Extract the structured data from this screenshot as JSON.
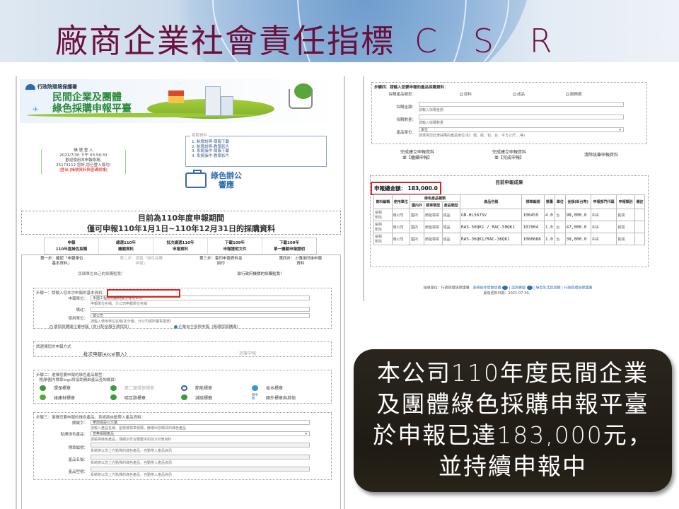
{
  "slide": {
    "title": "廠商企業社會責任指標",
    "title_suffix": "C S R"
  },
  "left_screenshot": {
    "agency": "行政院環境保護署",
    "site_title_line1": "民間企業及團體",
    "site_title_line2": "綠色採購申報平臺",
    "login": {
      "heading": "帳 號 登 入",
      "datetime": "2021/7/30 下午 03:56:33",
      "welcome": "歡迎使用本申報系統,",
      "user_msg": "25173112 您好,您已登入成功!",
      "logout": "|登出",
      "edit_account": "|帳號資料與密碼修護|"
    },
    "reference": {
      "legend": "相關資料",
      "items": [
        "1. 制度說明-簡報下載",
        "2. 制度說明-教學影片",
        "3. 系統操作-簡報下載",
        "4. 系統操作-教學影片"
      ]
    },
    "green_office": {
      "line1": "綠色辦公",
      "line2": "響應"
    },
    "period": {
      "line1": "目前為110年度申報期間",
      "line2": "僅可申報110年1月1日~110年12月31日的採購資料"
    },
    "tabs": [
      {
        "line1": "申報",
        "line2": "110年度綠色採購"
      },
      {
        "line1": "總選110年",
        "line2": "機關資料"
      },
      {
        "line1": "批次總選110年",
        "line2": "申報資料"
      },
      {
        "line1": "下載109年",
        "line2": "申報證明文件"
      },
      {
        "line1": "下載109年",
        "line2": "單一機關申報證明"
      }
    ],
    "steps": [
      {
        "line1": "第一步：確認「申報單位",
        "line2": "基本資料」",
        "dim": false
      },
      {
        "line1": "第二步：填報「綠色採購",
        "line2": "申報」",
        "dim": true
      },
      {
        "line1": "第三步：套印申報資料並",
        "line2": "用印",
        "dim": false
      },
      {
        "line1": "第四步：上傳用印後申報",
        "line2": "資料",
        "dim": false
      }
    ],
    "notes": [
      "民間單位自己的採購點我！",
      "執行政府機關的採購點我！"
    ],
    "step1": {
      "title": "步驟一：請輸入您本次申報的基本資料：",
      "unit_label": "申報單位：",
      "unit_value": "禾圃工程技術顧問股份有限公司",
      "unit_hint": "申報單位名稱、分公司申報單位名稱",
      "remark_label": "備註：",
      "remark_value": "",
      "user_unit_label": "使用單位：",
      "user_unit_value": "總公司",
      "user_unit_hint": "請輸入使用單位名稱(如分廠、分公司或所屬事業部)",
      "radio1": "環保局輔導企業申報（會分配金額至環保局）",
      "radio2": "企業自主參與申報（無環保局輔導）",
      "selected_radio": 2
    },
    "method": {
      "title": "請選擇您的申報方式",
      "batch": "批次申報(excel匯入)",
      "single": "逐筆申報"
    },
    "step2": {
      "title": "步驟二：選擇您要申報的綠色產品類型：",
      "subtitle": "（點擊圖內標章logo將協助開啟產品查詢網頁）",
      "marks": [
        {
          "label": "環保標章",
          "icon": "eco-label-icon",
          "color": "#3b9a3b",
          "dim": false
        },
        {
          "label": "第二類環保標章",
          "icon": "type2-eco-label-icon",
          "color": "#3b9a3b",
          "dim": true
        },
        {
          "label": "節能標章",
          "icon": "energy-label-icon",
          "color": "#2c5fb0",
          "dim": false
        },
        {
          "label": "省水標章",
          "icon": "water-label-icon",
          "color": "#2a9ad8",
          "dim": false
        },
        {
          "label": "綠建材標章",
          "icon": "green-building-label-icon",
          "color": "#5aa53c",
          "dim": false
        },
        {
          "label": "碳足跡標章",
          "icon": "carbon-footprint-label-icon",
          "color": "#3b9a3b",
          "dim": false
        },
        {
          "label": "減碳標籤",
          "icon": "carbon-reduction-label-icon",
          "color": "#3b9a3b",
          "dim": false
        },
        {
          "label": "國外標章與其他",
          "icon": "foreign-label-icon",
          "color": "#3a67a8",
          "dim": false
        }
      ],
      "carbon_neutral": "碳中\n和"
    },
    "step3": {
      "title": "步驟三：選擇您要申報的綠色產品，系統將自動帶入產品資料：",
      "keyword_label": "關鍵字：",
      "keyword_value": "華鼎開設公文櫃",
      "keyword_hint": "請輸入產品名稱、型號或標章號碼，篩選出您購買的綠色產品",
      "product_label": "點擇綠色產品：",
      "product_value": "查無相關產品",
      "product_hint": "請點擇綠色產品，僅顯示符合關鍵字的前100筆資料",
      "cert_label": "標章編號：",
      "name_label": "產品名稱：",
      "model_label": "產品型號：",
      "auto_hint": "系統將以您上方點擇的綠色產品，自動帶入產品資訊"
    }
  },
  "right_screenshot": {
    "step4": {
      "title": "步驟四：請輸入您要申報的產品採購資料：",
      "type_label": "採購產品類型：",
      "type_options": [
        "原料",
        "成品",
        "服務類"
      ],
      "amount_label": "採購金額：",
      "amount_hint": "請輸入採購金額",
      "qty_label": "採購數量：",
      "qty_hint": "請輸入採購數量",
      "unit_label": "產品單位：",
      "unit_value": "單位",
      "unit_hint": "請選擇您此筆採購的產品單位(如：個、瓶、包、台、平方公尺....等)"
    },
    "actions": [
      {
        "line1": "完成建立申報資料",
        "line2": "並【繼續申報】"
      },
      {
        "line1": "完成建立申報資料",
        "line2": "並【完成申報】"
      },
      {
        "line1": "清除該筆申報資料",
        "line2": ""
      }
    ],
    "results": {
      "title": "目前申報成果",
      "total_label": "申報總金額：",
      "total_value": "183,000.0",
      "headers": {
        "record": "資料編輯",
        "user_unit": "使用單位",
        "green_type": "綠色產品種類",
        "domestic": "國內外",
        "label_type": "標章類型",
        "product_type": "產品類型",
        "product_name": "產品名稱",
        "cert_no": "標章編號",
        "qty": "數量",
        "unit": "單位",
        "amount": "金額(新台幣)",
        "agency_code": "申報部門代碼",
        "category": "申報類別",
        "remark": "備註"
      },
      "rows": [
        {
          "record": "編輯\n刪除",
          "user_unit": "總公司",
          "domestic": "國內",
          "label_type": "節能標章",
          "product_type": "成品",
          "product_name": "GN-HL567SV",
          "cert_no": "106459",
          "qty": "4.0",
          "unit": "台",
          "amount": "98,000.0",
          "agency_code": "中央",
          "category": "民間",
          "remark": ""
        },
        {
          "record": "編輯\n刪除",
          "user_unit": "總公司",
          "domestic": "國內",
          "label_type": "節能標章",
          "product_type": "成品",
          "product_name": "RAS-50QK1 / RAC-50QK1",
          "cert_no": "107004",
          "qty": "1.0",
          "unit": "台",
          "amount": "47,000.0",
          "agency_code": "中央",
          "category": "民間",
          "remark": ""
        },
        {
          "record": "編輯\n刪除",
          "user_unit": "總公司",
          "domestic": "國內",
          "label_type": "節能標章",
          "product_type": "成品",
          "product_name": "RAS-36QK1/RAC-36QK1",
          "cert_no": "1080688",
          "qty": "1.0",
          "unit": "台",
          "amount": "38,000.0",
          "agency_code": "中央",
          "category": "民間",
          "remark": ""
        }
      ]
    },
    "footer": {
      "supervisor": "指導單位：行政院環境保護署",
      "link1": "系統操作問題信箱",
      "link2": "諮詢專線",
      "link3": "綠色生活資訊網",
      "link4": "行政院環境保護署",
      "updated": "最後更新日期：2021-07-30。"
    }
  },
  "callout": {
    "line1": "本公司110年度民間企業",
    "line2": "及團體綠色採購申報平臺",
    "line3": "於申報已達183,000元，",
    "line4": "並持續申報中"
  }
}
